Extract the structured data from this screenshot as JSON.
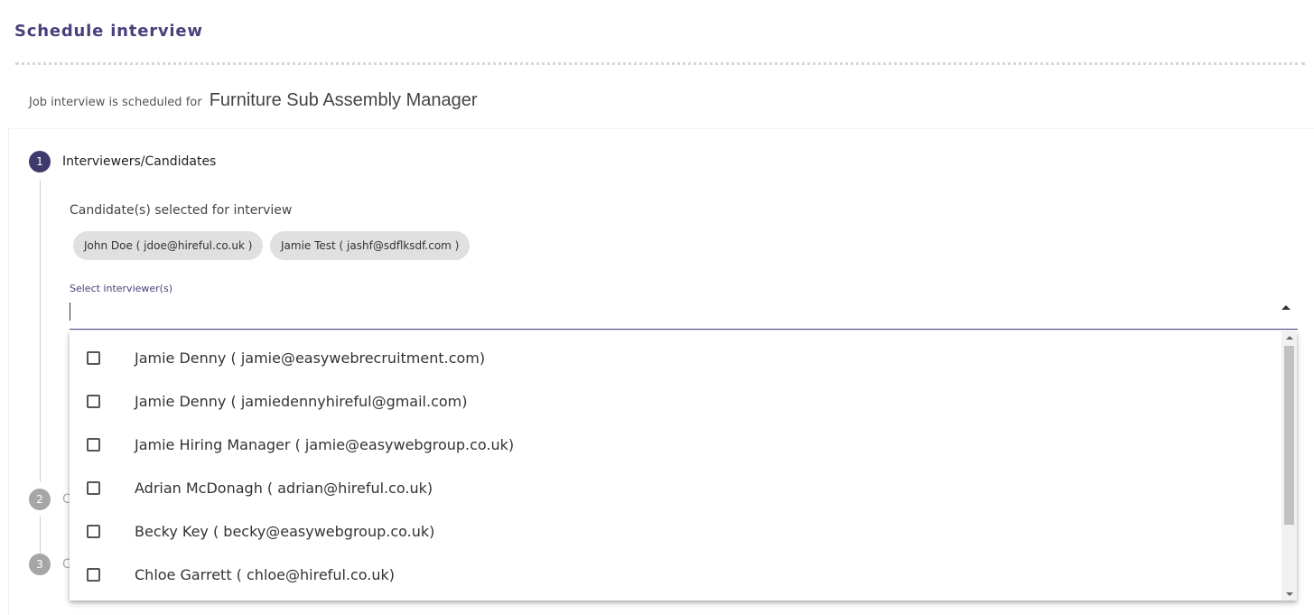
{
  "page": {
    "title": "Schedule interview",
    "job_prefix": "Job interview is scheduled for",
    "job_title": "Furniture Sub Assembly Manager"
  },
  "stepper": {
    "steps": [
      {
        "number": "1",
        "label": "Interviewers/Candidates",
        "state": "active"
      },
      {
        "number": "2",
        "label": "C",
        "state": "inactive"
      },
      {
        "number": "3",
        "label": "C",
        "state": "inactive"
      }
    ]
  },
  "candidates": {
    "label": "Candidate(s) selected for interview",
    "chips": [
      "John Doe ( jdoe@hireful.co.uk )",
      "Jamie Test ( jashf@sdflksdf.com )"
    ]
  },
  "interviewers": {
    "field_label": "Select interviewer(s)",
    "value": "",
    "dropdown_open": true,
    "options": [
      {
        "label": "Jamie Denny ( jamie@easywebrecruitment.com)",
        "checked": false
      },
      {
        "label": "Jamie Denny ( jamiedennyhireful@gmail.com)",
        "checked": false
      },
      {
        "label": "Jamie Hiring Manager ( jamie@easywebgroup.co.uk)",
        "checked": false
      },
      {
        "label": "Adrian McDonagh ( adrian@hireful.co.uk)",
        "checked": false
      },
      {
        "label": "Becky Key ( becky@easywebgroup.co.uk)",
        "checked": false
      },
      {
        "label": "Chloe Garrett ( chloe@hireful.co.uk)",
        "checked": false
      }
    ]
  },
  "colors": {
    "accent": "#4a3f7a",
    "step_active": "#3e3a6b",
    "step_inactive": "#a6a6a6",
    "chip_bg": "#e0e0e0"
  },
  "icons": {
    "dropdown_toggle": "caret-up-icon",
    "checkbox": "checkbox-unchecked-icon"
  }
}
